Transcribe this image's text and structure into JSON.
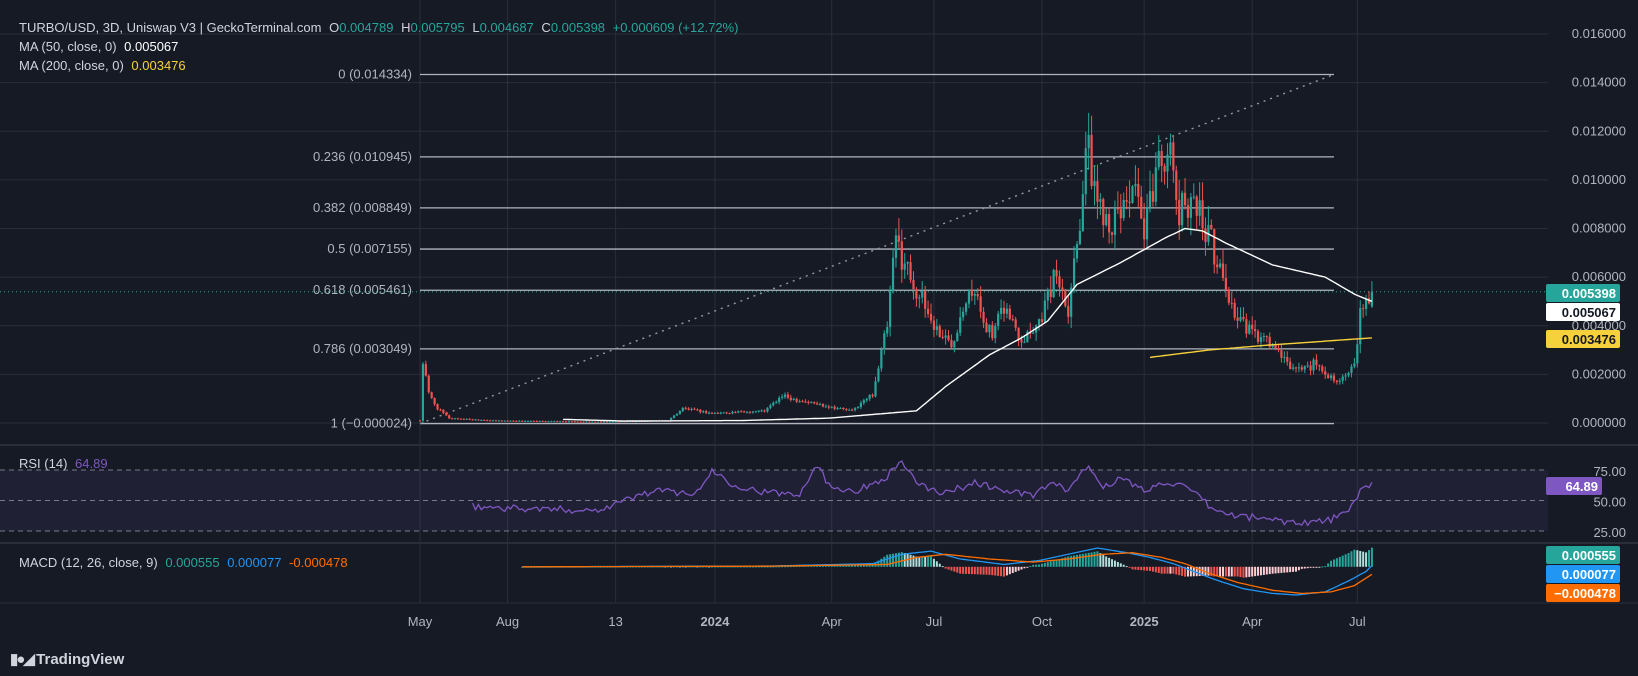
{
  "header": {
    "symbol": "TURBO/USD, 3D, Uniswap V3 | GeckoTerminal.com",
    "o_label": "O",
    "o": "0.004789",
    "h_label": "H",
    "h": "0.005795",
    "l_label": "L",
    "l": "0.004687",
    "c_label": "C",
    "c": "0.005398",
    "change": "+0.000609 (+12.72%)"
  },
  "ma50": {
    "label": "MA (50, close, 0)",
    "value": "0.005067",
    "color": "#ffffff"
  },
  "ma200": {
    "label": "MA (200, close, 0)",
    "value": "0.003476",
    "color": "#f7d13b"
  },
  "rsi": {
    "label": "RSI (14)",
    "value": "64.89",
    "color": "#7e57c2"
  },
  "macd": {
    "label": "MACD (12, 26, close, 9)",
    "v1": "0.000555",
    "v2": "0.000077",
    "v3": "-0.000478",
    "v3_badge": "−0.000478"
  },
  "watermark": "TradingView",
  "chart_data": {
    "type": "candlestick",
    "price_axis": {
      "ticks": [
        "0.016000",
        "0.014000",
        "0.012000",
        "0.010000",
        "0.008000",
        "0.006000",
        "0.004000",
        "0.002000",
        "0.000000"
      ],
      "tick_values": [
        0.016,
        0.014,
        0.012,
        0.01,
        0.008,
        0.006,
        0.004,
        0.002,
        0.0
      ],
      "range": [
        -0.00045,
        0.0171
      ]
    },
    "time_axis": {
      "labels": [
        "May",
        "Aug",
        "13",
        "2024",
        "Apr",
        "Jul",
        "Oct",
        "2025",
        "Apr",
        "Jul"
      ],
      "bold": [
        false,
        false,
        false,
        true,
        false,
        false,
        false,
        true,
        false,
        false
      ],
      "bar_index": [
        0,
        30,
        67,
        101,
        141,
        176,
        213,
        248,
        285,
        321
      ]
    },
    "fibonacci": [
      {
        "level": "0",
        "price": "0.014334",
        "value": 0.014334
      },
      {
        "level": "0.236",
        "price": "0.010945",
        "value": 0.010945
      },
      {
        "level": "0.382",
        "price": "0.008849",
        "value": 0.008849
      },
      {
        "level": "0.5",
        "price": "0.007155",
        "value": 0.007155
      },
      {
        "level": "0.618",
        "price": "0.005461",
        "value": 0.005461
      },
      {
        "level": "0.786",
        "price": "0.003049",
        "value": 0.003049
      },
      {
        "level": "1",
        "price": "−0.000024",
        "value": -2.4e-05
      }
    ],
    "price_keypoints": [
      [
        0,
        0.0001
      ],
      [
        1,
        0.0025
      ],
      [
        3,
        0.0012
      ],
      [
        6,
        0.0006
      ],
      [
        10,
        0.0002
      ],
      [
        25,
        0.0001
      ],
      [
        60,
        5e-05
      ],
      [
        85,
        0.0001
      ],
      [
        90,
        0.0006
      ],
      [
        100,
        0.0004
      ],
      [
        118,
        0.0005
      ],
      [
        124,
        0.0011
      ],
      [
        135,
        0.0008
      ],
      [
        148,
        0.0005
      ],
      [
        155,
        0.0012
      ],
      [
        160,
        0.004
      ],
      [
        163,
        0.0075
      ],
      [
        170,
        0.0055
      ],
      [
        176,
        0.004
      ],
      [
        182,
        0.0032
      ],
      [
        188,
        0.0058
      ],
      [
        196,
        0.0035
      ],
      [
        200,
        0.0048
      ],
      [
        206,
        0.0035
      ],
      [
        212,
        0.0042
      ],
      [
        218,
        0.0062
      ],
      [
        222,
        0.0048
      ],
      [
        226,
        0.0085
      ],
      [
        228,
        0.0115
      ],
      [
        232,
        0.0092
      ],
      [
        238,
        0.0082
      ],
      [
        244,
        0.0098
      ],
      [
        248,
        0.0075
      ],
      [
        252,
        0.0105
      ],
      [
        256,
        0.0115
      ],
      [
        260,
        0.0085
      ],
      [
        264,
        0.0095
      ],
      [
        270,
        0.0078
      ],
      [
        276,
        0.0055
      ],
      [
        280,
        0.0042
      ],
      [
        286,
        0.0036
      ],
      [
        292,
        0.0032
      ],
      [
        296,
        0.0025
      ],
      [
        300,
        0.0022
      ],
      [
        306,
        0.0024
      ],
      [
        312,
        0.0019
      ],
      [
        316,
        0.0018
      ],
      [
        320,
        0.0023
      ],
      [
        322,
        0.0045
      ],
      [
        324,
        0.0048
      ],
      [
        326,
        0.0054
      ]
    ],
    "ma50_keypoints": [
      [
        49,
        0.00015
      ],
      [
        70,
        8e-05
      ],
      [
        110,
        0.0001
      ],
      [
        140,
        0.0002
      ],
      [
        170,
        0.0005
      ],
      [
        180,
        0.0015
      ],
      [
        195,
        0.0028
      ],
      [
        206,
        0.0035
      ],
      [
        215,
        0.0042
      ],
      [
        225,
        0.0057
      ],
      [
        240,
        0.0066
      ],
      [
        255,
        0.0076
      ],
      [
        262,
        0.008
      ],
      [
        268,
        0.0079
      ],
      [
        276,
        0.0074
      ],
      [
        292,
        0.0065
      ],
      [
        310,
        0.006
      ],
      [
        320,
        0.0053
      ],
      [
        326,
        0.005
      ]
    ],
    "ma200_keypoints": [
      [
        250,
        0.0027
      ],
      [
        270,
        0.003
      ],
      [
        290,
        0.0032
      ],
      [
        326,
        0.0035
      ]
    ],
    "rsi_keypoints": [
      [
        18,
        45
      ],
      [
        40,
        43
      ],
      [
        60,
        42
      ],
      [
        70,
        50
      ],
      [
        80,
        58
      ],
      [
        95,
        56
      ],
      [
        100,
        75
      ],
      [
        106,
        65
      ],
      [
        112,
        60
      ],
      [
        120,
        56
      ],
      [
        130,
        56
      ],
      [
        136,
        80
      ],
      [
        140,
        62
      ],
      [
        150,
        58
      ],
      [
        160,
        70
      ],
      [
        165,
        83
      ],
      [
        170,
        63
      ],
      [
        180,
        56
      ],
      [
        190,
        65
      ],
      [
        200,
        58
      ],
      [
        210,
        54
      ],
      [
        216,
        64
      ],
      [
        222,
        58
      ],
      [
        228,
        78
      ],
      [
        234,
        62
      ],
      [
        240,
        68
      ],
      [
        248,
        58
      ],
      [
        256,
        66
      ],
      [
        262,
        60
      ],
      [
        266,
        54
      ],
      [
        272,
        42
      ],
      [
        278,
        38
      ],
      [
        290,
        35
      ],
      [
        300,
        32
      ],
      [
        310,
        33
      ],
      [
        318,
        40
      ],
      [
        322,
        58
      ],
      [
        326,
        64.89
      ]
    ],
    "rsi_axis": {
      "ticks": [
        "75.00",
        "50.00",
        "25.00"
      ],
      "tick_values": [
        75,
        50,
        25
      ]
    },
    "macd_keypoints": [
      [
        35,
        0.0
      ],
      [
        80,
        3e-05
      ],
      [
        120,
        5e-05
      ],
      [
        155,
        0.0002
      ],
      [
        165,
        0.0008
      ],
      [
        175,
        0.001
      ],
      [
        185,
        0.0005
      ],
      [
        200,
        0.00015
      ],
      [
        212,
        0.0004
      ],
      [
        222,
        0.0008
      ],
      [
        232,
        0.0012
      ],
      [
        242,
        0.0009
      ],
      [
        250,
        0.0006
      ],
      [
        258,
        0.0002
      ],
      [
        265,
        -0.0003
      ],
      [
        272,
        -0.0008
      ],
      [
        282,
        -0.0014
      ],
      [
        292,
        -0.0017
      ],
      [
        300,
        -0.0018
      ],
      [
        310,
        -0.0016
      ],
      [
        318,
        -0.0009
      ],
      [
        324,
        -0.0003
      ],
      [
        326,
        7.7e-05
      ]
    ],
    "signal_keypoints": [
      [
        35,
        0.0
      ],
      [
        80,
        2e-05
      ],
      [
        120,
        4e-05
      ],
      [
        160,
        0.00015
      ],
      [
        170,
        0.0006
      ],
      [
        180,
        0.0008
      ],
      [
        195,
        0.0005
      ],
      [
        210,
        0.0003
      ],
      [
        222,
        0.0005
      ],
      [
        234,
        0.0008
      ],
      [
        244,
        0.0009
      ],
      [
        254,
        0.0006
      ],
      [
        262,
        0.0002
      ],
      [
        270,
        -0.0004
      ],
      [
        280,
        -0.001
      ],
      [
        292,
        -0.0015
      ],
      [
        302,
        -0.0017
      ],
      [
        312,
        -0.0016
      ],
      [
        320,
        -0.0012
      ],
      [
        326,
        -0.000478
      ]
    ],
    "badges": {
      "price": "0.005398",
      "ma50": "0.005067",
      "ma200": "0.003476"
    }
  },
  "colors": {
    "background": "#161a25",
    "up": "#26a69a",
    "down": "#ef5350",
    "ma50": "#ffffff",
    "ma200": "#f7d13b",
    "rsi": "#7e57c2",
    "macd": "#2196f3",
    "signal": "#ff6d00",
    "fib": "#b2b5be",
    "grid": "#2a2e39",
    "price_badge": "#26a69a"
  }
}
